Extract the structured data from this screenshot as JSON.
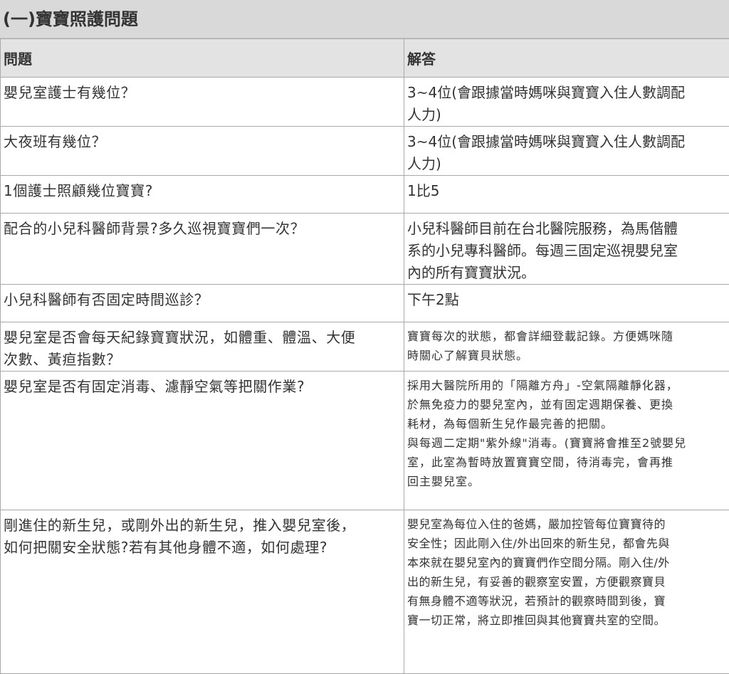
{
  "page": {
    "title": "(一)寶寶照護問題"
  },
  "table": {
    "headers": [
      "問題",
      "解答"
    ],
    "rows": [
      {
        "question": [
          "嬰兒室護士有幾位？"
        ],
        "answer": [
          "3~4位(會跟據當時媽咪與寶寶入住人數調配",
          "人力)"
        ]
      },
      {
        "question": [
          "大夜班有幾位？"
        ],
        "answer": [
          "3~4位(會跟據當時媽咪與寶寶入住人數調配",
          "人力)"
        ]
      },
      {
        "question": [
          "1個護士照顧幾位寶寶?"
        ],
        "answer": [
          "1比5"
        ]
      },
      {
        "question": [
          "配合的小兒科醫師背景?多久巡視寶寶們一次？"
        ],
        "answer": [
          "小兒科醫師目前在台北醫院服務，為馬偕體",
          "系的小兒專科醫師。每週三固定巡視嬰兒室",
          "內的所有寶寶狀況。"
        ]
      },
      {
        "question": [
          "小兒科醫師有否固定時間巡診？"
        ],
        "answer": [
          "下午2點"
        ]
      },
      {
        "question": [
          "嬰兒室是否會每天紀錄寶寶狀況，如體重、體溫、大便",
          "次數、黃疸指數？"
        ],
        "answer": [
          "寶寶每次的狀態，都會詳細登載記錄。方便媽咪隨",
          "時關心了解寶貝狀態。"
        ]
      },
      {
        "question": [
          "嬰兒室是否有固定消毒、濾靜空氣等把關作業?"
        ],
        "answer": [
          "採用大醫院所用的「隔離方舟」-空氣隔離靜化器，",
          "於無免疫力的嬰兒室內，並有固定週期保養、更換",
          "耗材，為每個新生兒作最完善的把關。",
          "與每週二定期\"紫外線\"消毒。(寶寶將會推至2號嬰兒",
          "室，此室為暫時放置寶寶空間，待消毒完，會再推",
          "回主嬰兒室。"
        ]
      },
      {
        "question": [
          "剛進住的新生兒，或剛外出的新生兒，推入嬰兒室後，",
          "如何把關安全狀態?若有其他身體不適，如何處理?"
        ],
        "answer": [
          "嬰兒室為每位入住的爸媽，嚴加控管每位寶寶待的",
          "安全性；因此剛入住/外出回來的新生兒，都會先與",
          "本來就在嬰兒室內的寶寶們作空間分隔。剛入住/外",
          "出的新生兒，有妥善的觀察室安置，方便觀察寶貝",
          "有無身體不適等狀況，若預計的觀察時間到後，寶",
          "寶一切正常，將立即推回與其他寶寶共室的空間。"
        ]
      }
    ]
  }
}
